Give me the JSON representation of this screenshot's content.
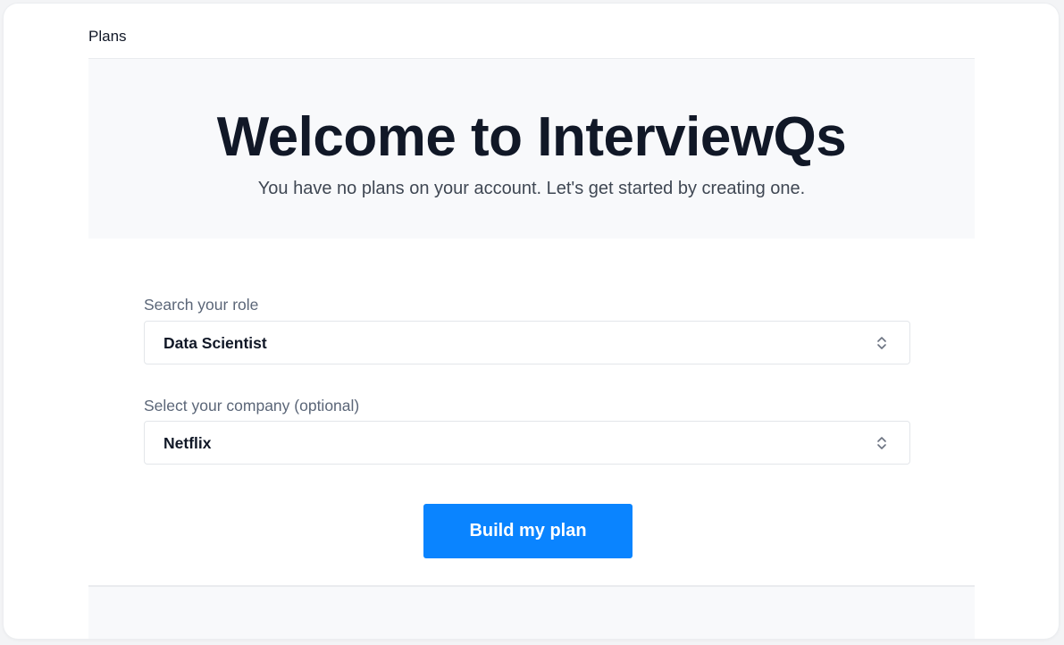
{
  "breadcrumb": {
    "label": "Plans"
  },
  "hero": {
    "title": "Welcome to InterviewQs",
    "subtitle": "You have no plans on your account. Let's get started by creating one."
  },
  "form": {
    "role": {
      "label": "Search your role",
      "value": "Data Scientist",
      "icon": "chevron-up-down-icon"
    },
    "company": {
      "label": "Select your company (optional)",
      "value": "Netflix",
      "icon": "chevron-up-down-icon"
    },
    "submit_label": "Build my plan"
  },
  "colors": {
    "accent": "#0a84ff",
    "heading": "#111827",
    "muted": "#5b6678",
    "hero_bg": "#f8f9fb"
  }
}
